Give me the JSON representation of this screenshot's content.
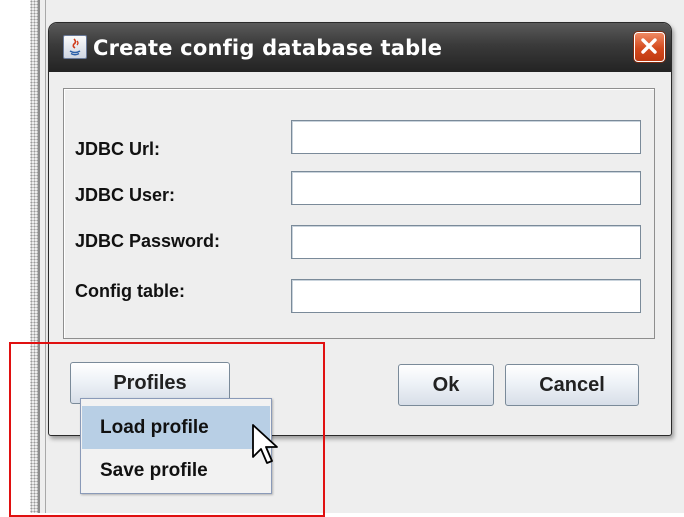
{
  "dialog": {
    "title": "Create config database table",
    "close_icon": "close-icon",
    "app_icon": "java-icon"
  },
  "form": {
    "fields": [
      {
        "label": "JDBC Url:",
        "value": ""
      },
      {
        "label": "JDBC User:",
        "value": ""
      },
      {
        "label": "JDBC Password:",
        "value": ""
      },
      {
        "label": "Config table:",
        "value": ""
      }
    ]
  },
  "buttons": {
    "profiles": "Profiles",
    "ok": "Ok",
    "cancel": "Cancel"
  },
  "popup_menu": {
    "items": [
      {
        "label": "Load profile",
        "highlighted": true
      },
      {
        "label": "Save profile",
        "highlighted": false
      }
    ]
  },
  "colors": {
    "title_bar": "#3a3a3a",
    "close_button": "#d44a1e",
    "menu_highlight": "#b8cfe5",
    "annotation_box": "#e01010"
  }
}
